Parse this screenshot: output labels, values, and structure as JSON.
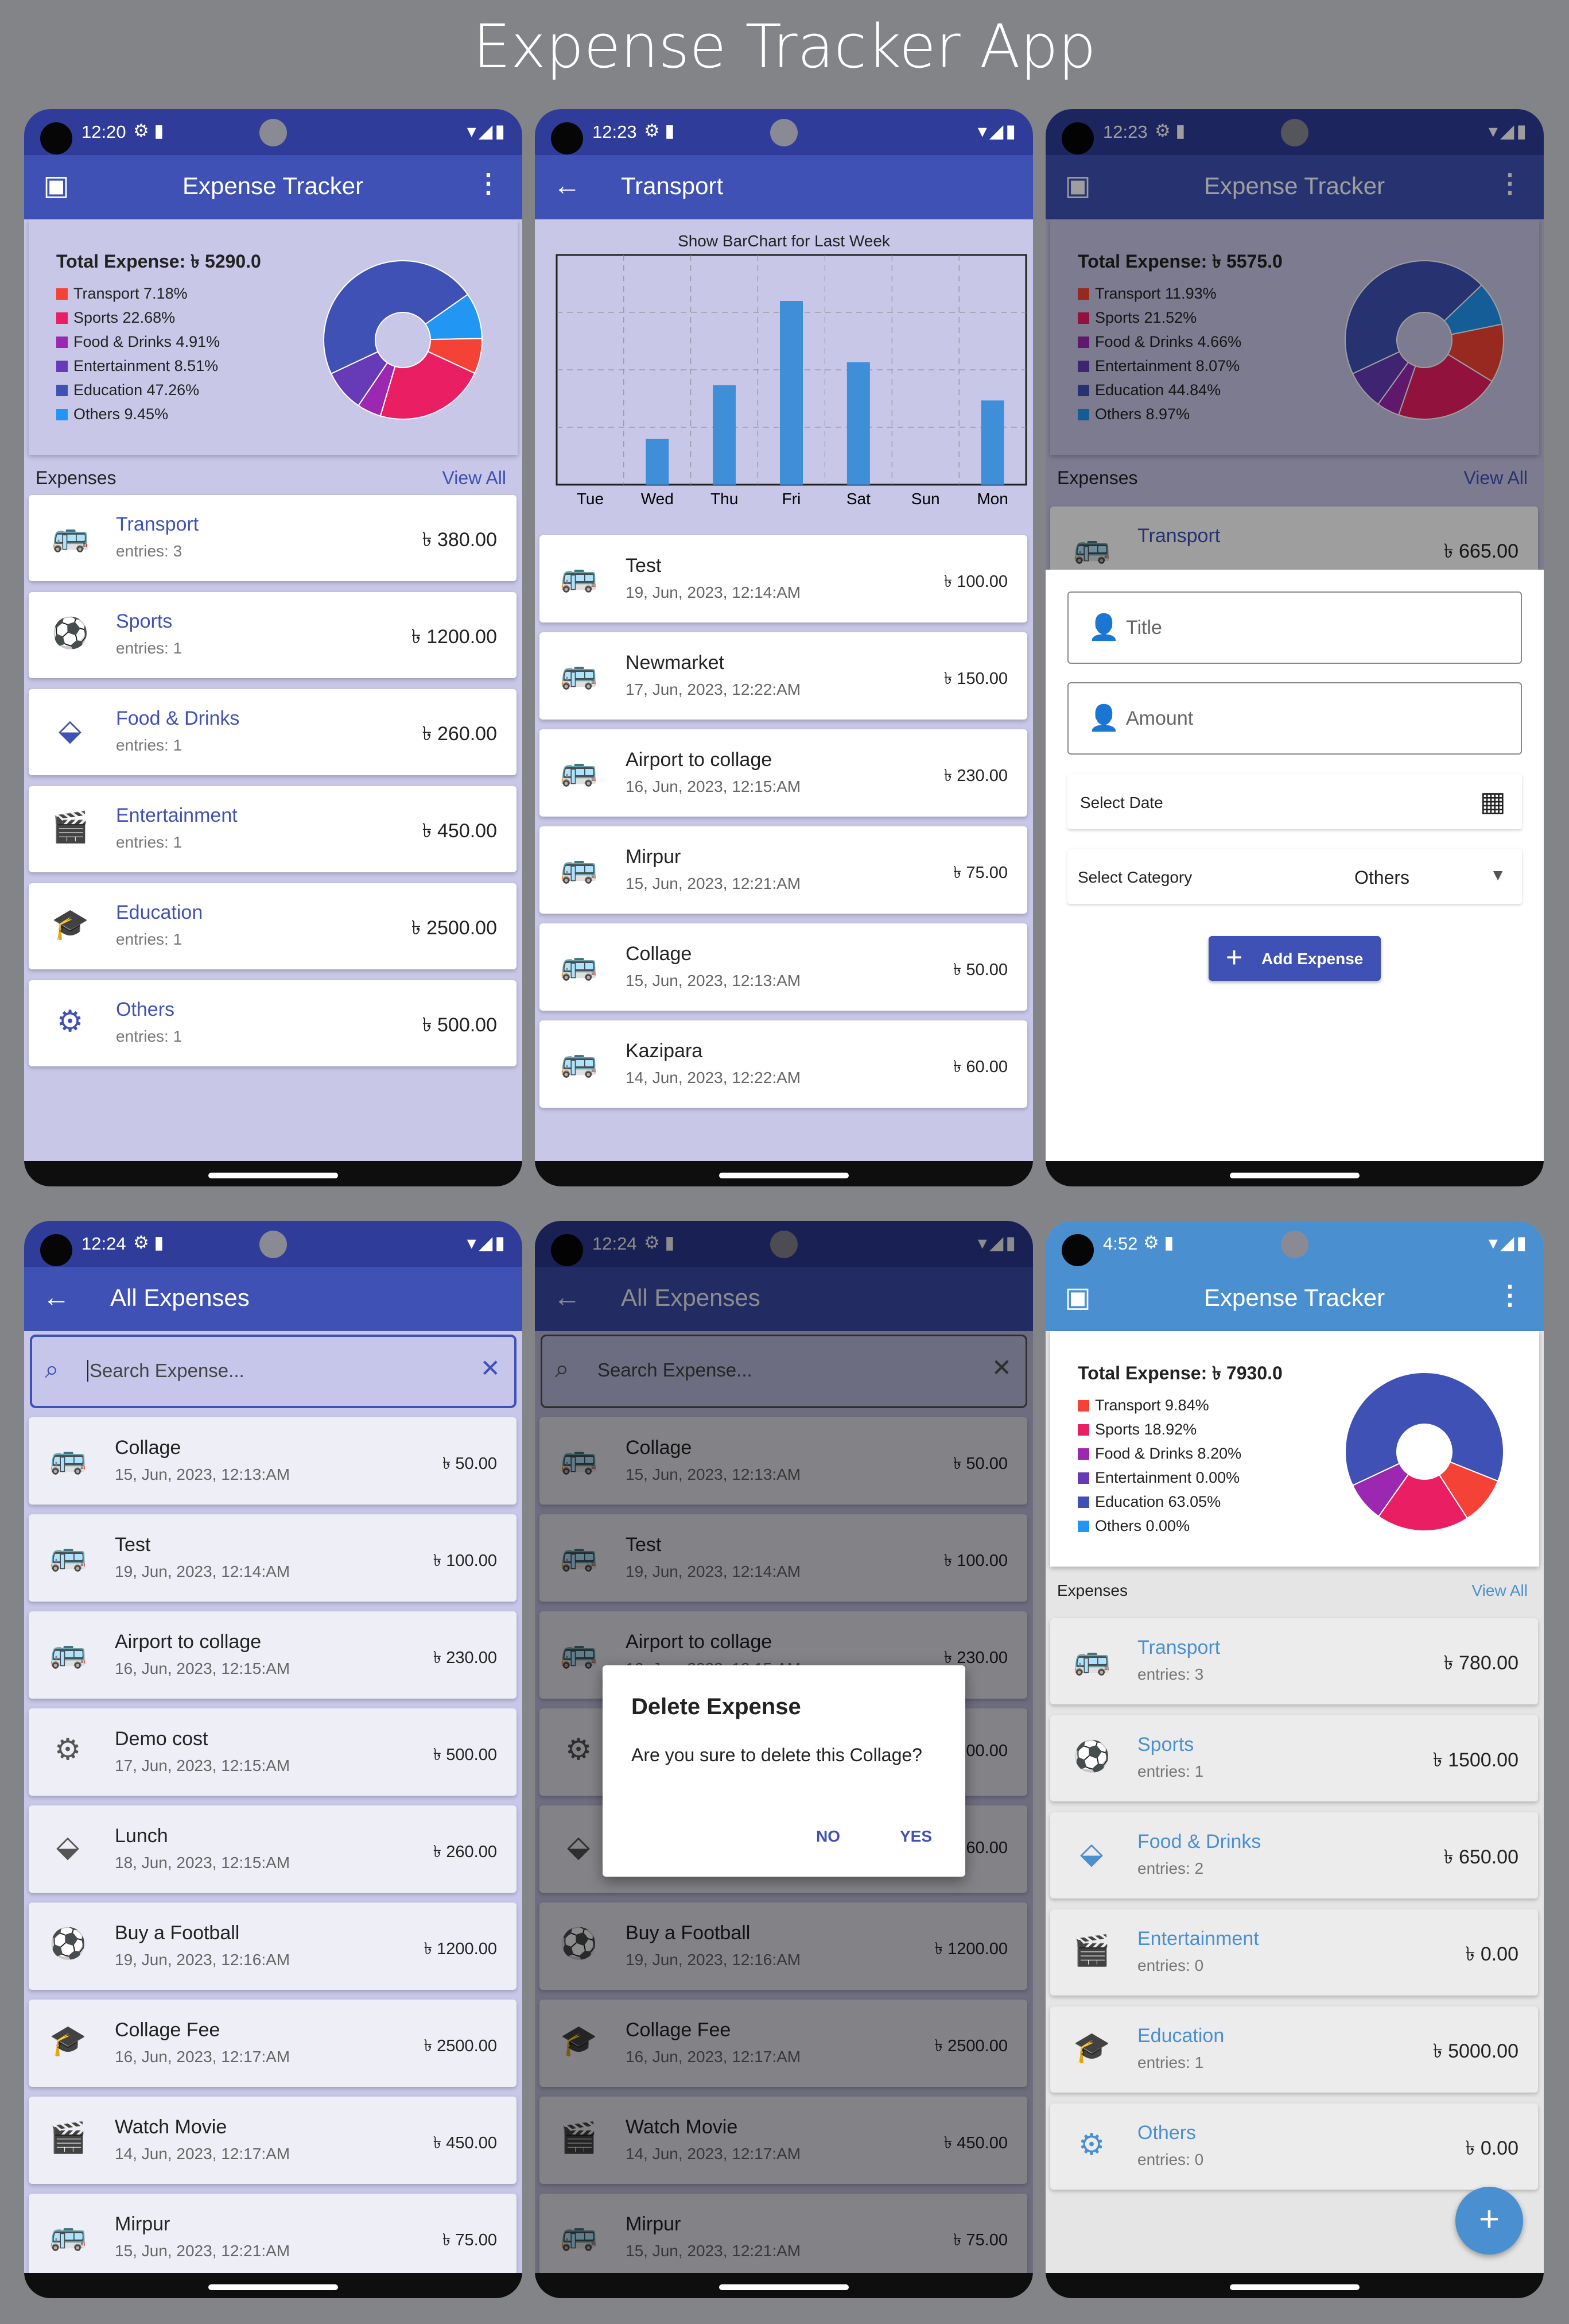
{
  "page_title": "Expense Tracker App",
  "colors": {
    "primary": "#3f51b5",
    "primary_dark": "#2f3c99",
    "light_blue": "#4a90d0",
    "bg_lavender": "#c8c7e8",
    "transport": "#f44336",
    "sports": "#e91e63",
    "food": "#9c27b0",
    "entertainment": "#673ab7",
    "education": "#3f51b5",
    "others": "#2196f3"
  },
  "icons": {
    "transport": "bus-icon",
    "sports": "soccer-ball-icon",
    "food": "food-icon",
    "entertainment": "clapperboard-icon",
    "education": "graduation-cap-icon",
    "others": "gears-icon"
  },
  "phone1": {
    "status_time": "12:20",
    "app_title": "Expense Tracker",
    "total": "Total Expense: ৳ 5290.0",
    "legend": [
      "Transport  7.18%",
      "Sports  22.68%",
      "Food & Drinks  4.91%",
      "Entertainment  8.51%",
      "Education  47.26%",
      "Others  9.45%"
    ],
    "pie": [
      7.18,
      22.68,
      4.91,
      8.51,
      47.26,
      9.45
    ],
    "expenses_label": "Expenses",
    "view_all": "View All",
    "categories": [
      {
        "name": "Transport",
        "entries": "entries: 3",
        "amount": "৳ 380.00"
      },
      {
        "name": "Sports",
        "entries": "entries: 1",
        "amount": "৳ 1200.00"
      },
      {
        "name": "Food & Drinks",
        "entries": "entries: 1",
        "amount": "৳ 260.00"
      },
      {
        "name": "Entertainment",
        "entries": "entries: 1",
        "amount": "৳ 450.00"
      },
      {
        "name": "Education",
        "entries": "entries: 1",
        "amount": "৳ 2500.00"
      },
      {
        "name": "Others",
        "entries": "entries: 1",
        "amount": "৳ 500.00"
      }
    ],
    "fab": "+"
  },
  "phone2": {
    "status_time": "12:23",
    "app_title": "Transport",
    "chart_data": {
      "type": "bar",
      "title": "Show BarChart for Last Week",
      "categories": [
        "Tue",
        "Wed",
        "Thu",
        "Fri",
        "Sat",
        "Sun",
        "Mon"
      ],
      "values": [
        0,
        30,
        65,
        120,
        80,
        0,
        55
      ]
    },
    "entries": [
      {
        "title": "Test",
        "date": "19, Jun, 2023, 12:14:AM",
        "amount": "৳ 100.00"
      },
      {
        "title": "Newmarket",
        "date": "17, Jun, 2023, 12:22:AM",
        "amount": "৳ 150.00"
      },
      {
        "title": "Airport to collage",
        "date": "16, Jun, 2023, 12:15:AM",
        "amount": "৳ 230.00"
      },
      {
        "title": "Mirpur",
        "date": "15, Jun, 2023, 12:21:AM",
        "amount": "৳ 75.00"
      },
      {
        "title": "Collage",
        "date": "15, Jun, 2023, 12:13:AM",
        "amount": "৳ 50.00"
      },
      {
        "title": "Kazipara",
        "date": "14, Jun, 2023, 12:22:AM",
        "amount": "৳ 60.00"
      }
    ]
  },
  "phone3": {
    "status_time": "12:23",
    "app_title": "Expense Tracker",
    "total": "Total Expense: ৳ 5575.0",
    "legend": [
      "Transport  11.93%",
      "Sports  21.52%",
      "Food & Drinks  4.66%",
      "Entertainment  8.07%",
      "Education  44.84%",
      "Others  8.97%"
    ],
    "pie": [
      11.93,
      21.52,
      4.66,
      8.07,
      44.84,
      8.97
    ],
    "expenses_label": "Expenses",
    "view_all": "View All",
    "peek_category": "Transport",
    "peek_amount": "৳ 665.00",
    "title_placeholder": "Title",
    "amount_placeholder": "Amount",
    "select_date": "Select Date",
    "select_category": "Select Category",
    "category_value": "Others",
    "add_button": "Add Expense"
  },
  "phone4": {
    "status_time": "12:24",
    "app_title": "All Expenses",
    "search_placeholder": "Search Expense...",
    "entries": [
      {
        "title": "Collage",
        "date": "15, Jun, 2023, 12:13:AM",
        "amount": "৳ 50.00",
        "icon": "bus-icon"
      },
      {
        "title": "Test",
        "date": "19, Jun, 2023, 12:14:AM",
        "amount": "৳ 100.00",
        "icon": "bus-icon"
      },
      {
        "title": "Airport to collage",
        "date": "16, Jun, 2023, 12:15:AM",
        "amount": "৳ 230.00",
        "icon": "bus-icon"
      },
      {
        "title": "Demo cost",
        "date": "17, Jun, 2023, 12:15:AM",
        "amount": "৳ 500.00",
        "icon": "gears-icon"
      },
      {
        "title": "Lunch",
        "date": "18, Jun, 2023, 12:15:AM",
        "amount": "৳ 260.00",
        "icon": "food-icon"
      },
      {
        "title": "Buy a  Football",
        "date": "19, Jun, 2023, 12:16:AM",
        "amount": "৳ 1200.00",
        "icon": "soccer-ball-icon"
      },
      {
        "title": "Collage Fee",
        "date": "16, Jun, 2023, 12:17:AM",
        "amount": "৳ 2500.00",
        "icon": "graduation-cap-icon"
      },
      {
        "title": "Watch Movie",
        "date": "14, Jun, 2023, 12:17:AM",
        "amount": "৳ 450.00",
        "icon": "clapperboard-icon"
      },
      {
        "title": "Mirpur",
        "date": "15, Jun, 2023, 12:21:AM",
        "amount": "৳ 75.00",
        "icon": "bus-icon"
      }
    ]
  },
  "phone5": {
    "status_time": "12:24",
    "app_title": "All Expenses",
    "search_placeholder": "Search Expense...",
    "dialog_title": "Delete Expense",
    "dialog_message": "Are you sure to delete this Collage?",
    "no": "NO",
    "yes": "YES",
    "visible_amounts": [
      "৳ 50.00",
      "৳ 100.00",
      "৳ 230.00",
      "00.00",
      "60.00",
      "৳ 1200.00",
      "৳ 2500.00",
      "৳ 450.00",
      "৳ 75.00"
    ]
  },
  "phone6": {
    "status_time": "4:52",
    "app_title": "Expense Tracker",
    "total": "Total Expense: ৳ 7930.0",
    "legend": [
      "Transport  9.84%",
      "Sports  18.92%",
      "Food & Drinks  8.20%",
      "Entertainment  0.00%",
      "Education  63.05%",
      "Others  0.00%"
    ],
    "pie": [
      9.84,
      18.92,
      8.2,
      0.0,
      63.05,
      0.0
    ],
    "expenses_label": "Expenses",
    "view_all": "View All",
    "categories": [
      {
        "name": "Transport",
        "entries": "entries: 3",
        "amount": "৳ 780.00"
      },
      {
        "name": "Sports",
        "entries": "entries: 1",
        "amount": "৳ 1500.00"
      },
      {
        "name": "Food & Drinks",
        "entries": "entries: 2",
        "amount": "৳ 650.00"
      },
      {
        "name": "Entertainment",
        "entries": "entries: 0",
        "amount": "৳ 0.00"
      },
      {
        "name": "Education",
        "entries": "entries: 1",
        "amount": "৳ 5000.00"
      },
      {
        "name": "Others",
        "entries": "entries: 0",
        "amount": "৳ 0.00"
      }
    ],
    "fab": "+"
  }
}
